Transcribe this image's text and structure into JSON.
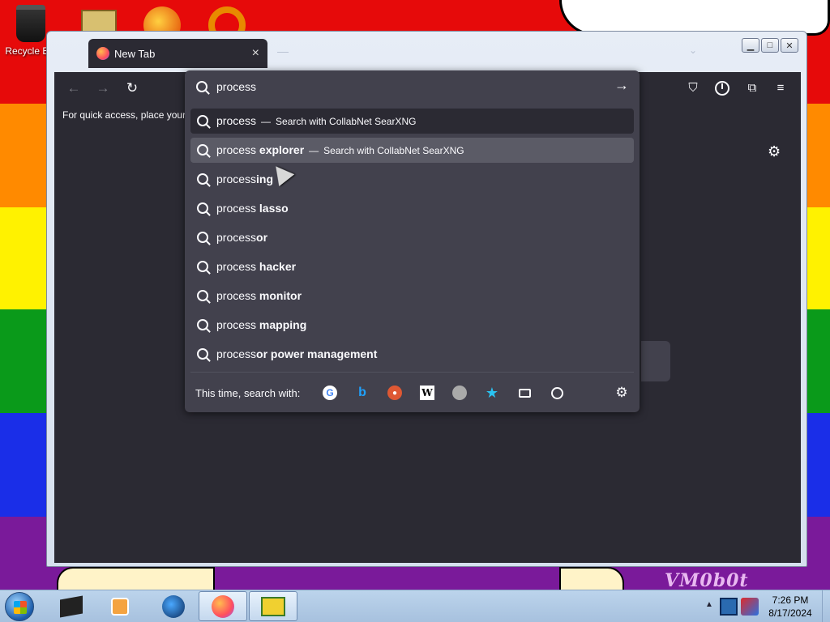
{
  "desktop": {
    "icons": [
      {
        "label": "Recycle Bin",
        "icon": "recycle-bin-icon"
      },
      {
        "label": "",
        "icon": "folder-icon"
      },
      {
        "label": "",
        "icon": "app-icon"
      },
      {
        "label": "",
        "icon": "app-icon"
      }
    ],
    "watermark": "VM0b0t"
  },
  "window": {
    "tab_title": "New Tab",
    "tab_close": "×"
  },
  "browser": {
    "bookmarks_hint": "For quick access, place your b",
    "urlbar": {
      "query": "process",
      "results": [
        {
          "prefix": "process",
          "bold": "",
          "separator": "—",
          "action": "Search with CollabNet SearXNG"
        },
        {
          "prefix": "process ",
          "bold": "explorer",
          "separator": "—",
          "action": "Search with CollabNet SearXNG"
        },
        {
          "prefix": "process",
          "bold": "ing",
          "separator": "",
          "action": ""
        },
        {
          "prefix": "process ",
          "bold": "lasso",
          "separator": "",
          "action": ""
        },
        {
          "prefix": "process",
          "bold": "or",
          "separator": "",
          "action": ""
        },
        {
          "prefix": "process ",
          "bold": "hacker",
          "separator": "",
          "action": ""
        },
        {
          "prefix": "process ",
          "bold": "monitor",
          "separator": "",
          "action": ""
        },
        {
          "prefix": "process ",
          "bold": "mapping",
          "separator": "",
          "action": ""
        },
        {
          "prefix": "process",
          "bold": "or power management",
          "separator": "",
          "action": ""
        }
      ],
      "oneoff_label": "This time, search with:",
      "engines": [
        "google-icon",
        "bing-icon",
        "duckduckgo-icon",
        "wikipedia-icon",
        "searxng-icon",
        "bookmarks-icon",
        "tabs-icon",
        "history-icon"
      ]
    }
  },
  "taskbar": {
    "clock_time": "7:26 PM",
    "clock_date": "8/17/2024"
  },
  "colors": {
    "browser_bg": "#2b2a33",
    "dropdown_bg": "#42414d",
    "selected_row": "#5b5b66",
    "text": "#fbfbfe"
  }
}
